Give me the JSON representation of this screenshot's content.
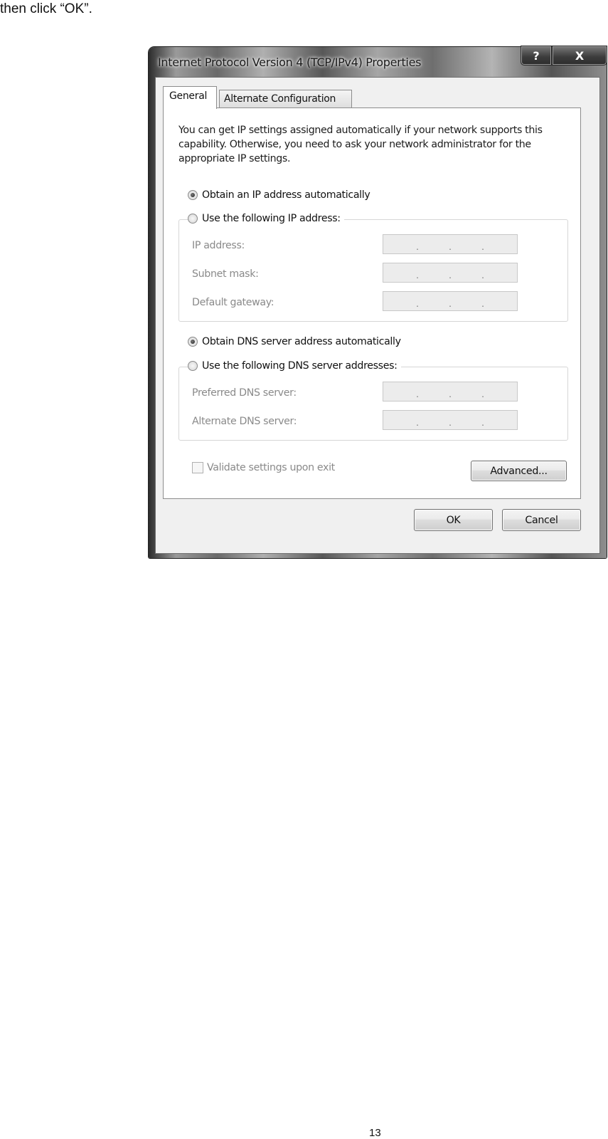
{
  "document": {
    "intro_text": "then click “OK”.",
    "page_number": "13"
  },
  "dialog": {
    "title": "Internet Protocol Version 4 (TCP/IPv4) Properties",
    "caption_buttons": {
      "help": "?",
      "close": "X"
    },
    "tabs": [
      {
        "label": "General",
        "active": true
      },
      {
        "label": "Alternate Configuration",
        "active": false
      }
    ],
    "description": "You can get IP settings assigned automatically if your network supports this capability. Otherwise, you need to ask your network administrator for the appropriate IP settings.",
    "ip_section": {
      "auto_option": {
        "label": "Obtain an IP address automatically",
        "checked": true
      },
      "manual_option": {
        "label": "Use the following IP address:",
        "checked": false
      },
      "fields": [
        {
          "label": "IP address:",
          "value": " .  .  . ",
          "enabled": false
        },
        {
          "label": "Subnet mask:",
          "value": " .  .  . ",
          "enabled": false
        },
        {
          "label": "Default gateway:",
          "value": " .  .  . ",
          "enabled": false
        }
      ]
    },
    "dns_section": {
      "auto_option": {
        "label": "Obtain DNS server address automatically",
        "checked": true
      },
      "manual_option": {
        "label": "Use the following DNS server addresses:",
        "checked": false
      },
      "fields": [
        {
          "label": "Preferred DNS server:",
          "value": " .  .  . ",
          "enabled": false
        },
        {
          "label": "Alternate DNS server:",
          "value": " .  .  . ",
          "enabled": false
        }
      ]
    },
    "validate_checkbox": {
      "label": "Validate settings upon exit",
      "checked": false,
      "enabled": false
    },
    "buttons": {
      "advanced": "Advanced...",
      "ok": "OK",
      "cancel": "Cancel"
    },
    "ip_separator": "."
  }
}
